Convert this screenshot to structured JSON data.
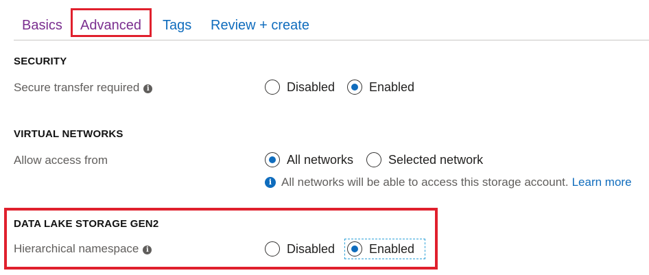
{
  "tabs": [
    {
      "label": "Basics"
    },
    {
      "label": "Advanced"
    },
    {
      "label": "Tags"
    },
    {
      "label": "Review + create"
    }
  ],
  "security": {
    "title": "SECURITY",
    "secure_transfer": {
      "label": "Secure transfer required",
      "options": [
        "Disabled",
        "Enabled"
      ],
      "selected": "Enabled"
    }
  },
  "virtual_networks": {
    "title": "VIRTUAL NETWORKS",
    "allow_access": {
      "label": "Allow access from",
      "options": [
        "All networks",
        "Selected network"
      ],
      "selected": "All networks"
    },
    "note_text": "All networks will be able to access this storage account.",
    "learn_more": "Learn more"
  },
  "data_lake": {
    "title": "DATA LAKE STORAGE GEN2",
    "hierarchical_namespace": {
      "label": "Hierarchical namespace",
      "options": [
        "Disabled",
        "Enabled"
      ],
      "selected": "Enabled"
    }
  },
  "colors": {
    "accent": "#0f6cbd",
    "visited_tab": "#7a2e8f",
    "highlight": "#e0202d"
  }
}
